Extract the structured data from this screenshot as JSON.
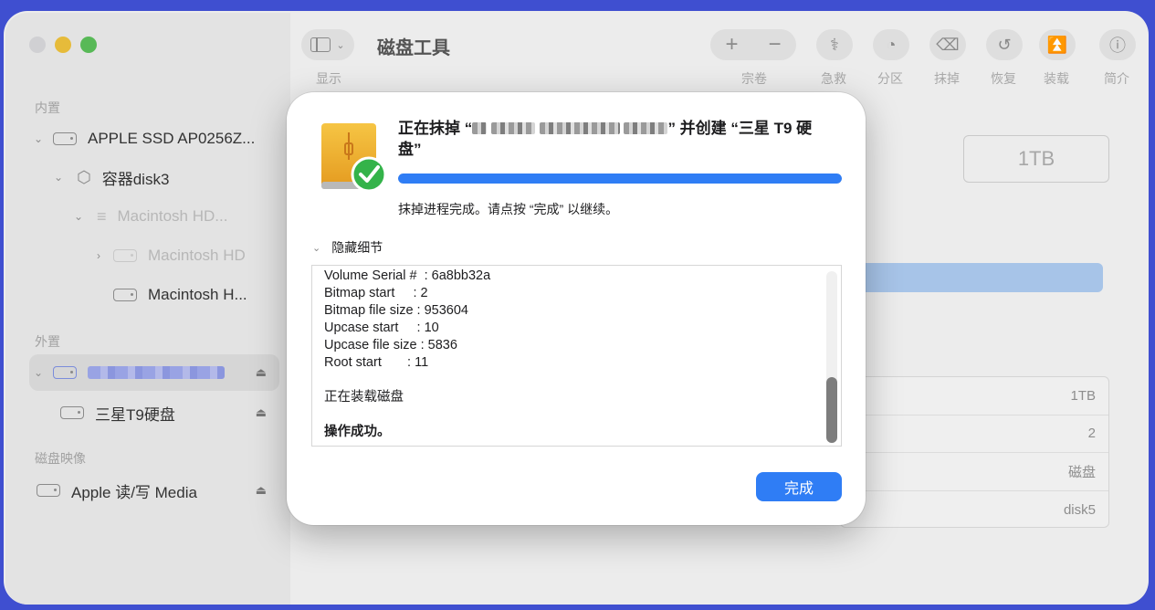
{
  "sidebar": {
    "sections": {
      "internal": "内置",
      "external": "外置",
      "images": "磁盘映像"
    },
    "items": [
      {
        "label": "APPLE SSD AP0256Z..."
      },
      {
        "label": "容器disk3"
      },
      {
        "label": "Macintosh HD..."
      },
      {
        "label": "Macintosh HD"
      },
      {
        "label": "Macintosh H..."
      },
      {
        "label": ""
      },
      {
        "label": "三星T9硬盘"
      },
      {
        "label": "Apple 读/写 Media"
      }
    ]
  },
  "toolbar": {
    "title": "磁盘工具",
    "view_label": "显示",
    "volume_label": "宗卷",
    "first_aid_label": "急救",
    "partition_label": "分区",
    "erase_label": "抹掉",
    "restore_label": "恢复",
    "mount_label": "装载",
    "info_label": "简介"
  },
  "main": {
    "capacity": "1TB",
    "info_rows": [
      "1TB",
      "2",
      "磁盘",
      "disk5"
    ]
  },
  "dialog": {
    "title_prefix": "正在抹掉 “",
    "title_suffix": "” 并创建 “三星 T9 硬盘”",
    "progress": 1.0,
    "status": "抹掉进程完成。请点按 “完成” 以继续。",
    "details_toggle": "隐藏细节",
    "log_lines": [
      "Volume Serial #  : 6a8bb32a",
      "Bitmap start     : 2",
      "Bitmap file size : 953604",
      "Upcase start     : 10",
      "Upcase file size : 5836",
      "Root start       : 11",
      "",
      "正在装载磁盘",
      "",
      "操作成功。"
    ],
    "done_label": "完成"
  },
  "colors": {
    "accent": "#2f7df5",
    "desktop": "#3f4fd0"
  }
}
